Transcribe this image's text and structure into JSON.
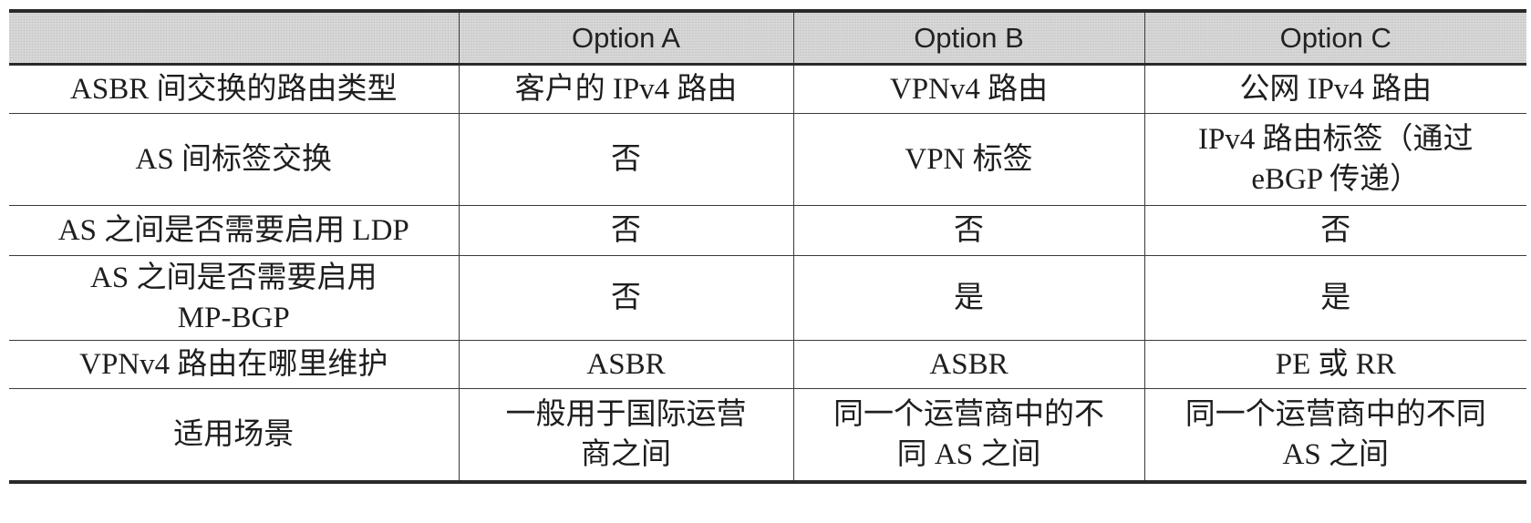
{
  "table": {
    "headers": [
      "",
      "Option A",
      "Option B",
      "Option C"
    ],
    "rows": [
      {
        "label": "ASBR 间交换的路由类型",
        "option_a": "客户的 IPv4 路由",
        "option_b": "VPNv4 路由",
        "option_c": "公网 IPv4 路由"
      },
      {
        "label": "AS 间标签交换",
        "option_a": "否",
        "option_b": "VPN 标签",
        "option_c": "IPv4 路由标签（通过 eBGP 传递）"
      },
      {
        "label": "AS 之间是否需要启用 LDP",
        "option_a": "否",
        "option_b": "否",
        "option_c": "否"
      },
      {
        "label": "AS 之间是否需要启用 MP-BGP",
        "option_a": "否",
        "option_b": "是",
        "option_c": "是"
      },
      {
        "label": "VPNv4 路由在哪里维护",
        "option_a": "ASBR",
        "option_b": "ASBR",
        "option_c": "PE 或 RR"
      },
      {
        "label": "适用场景",
        "option_a": "一般用于国际运营商之间",
        "option_b": "同一个运营商中的不同 AS 之间",
        "option_c": "同一个运营商中的不同 AS 之间"
      }
    ]
  }
}
